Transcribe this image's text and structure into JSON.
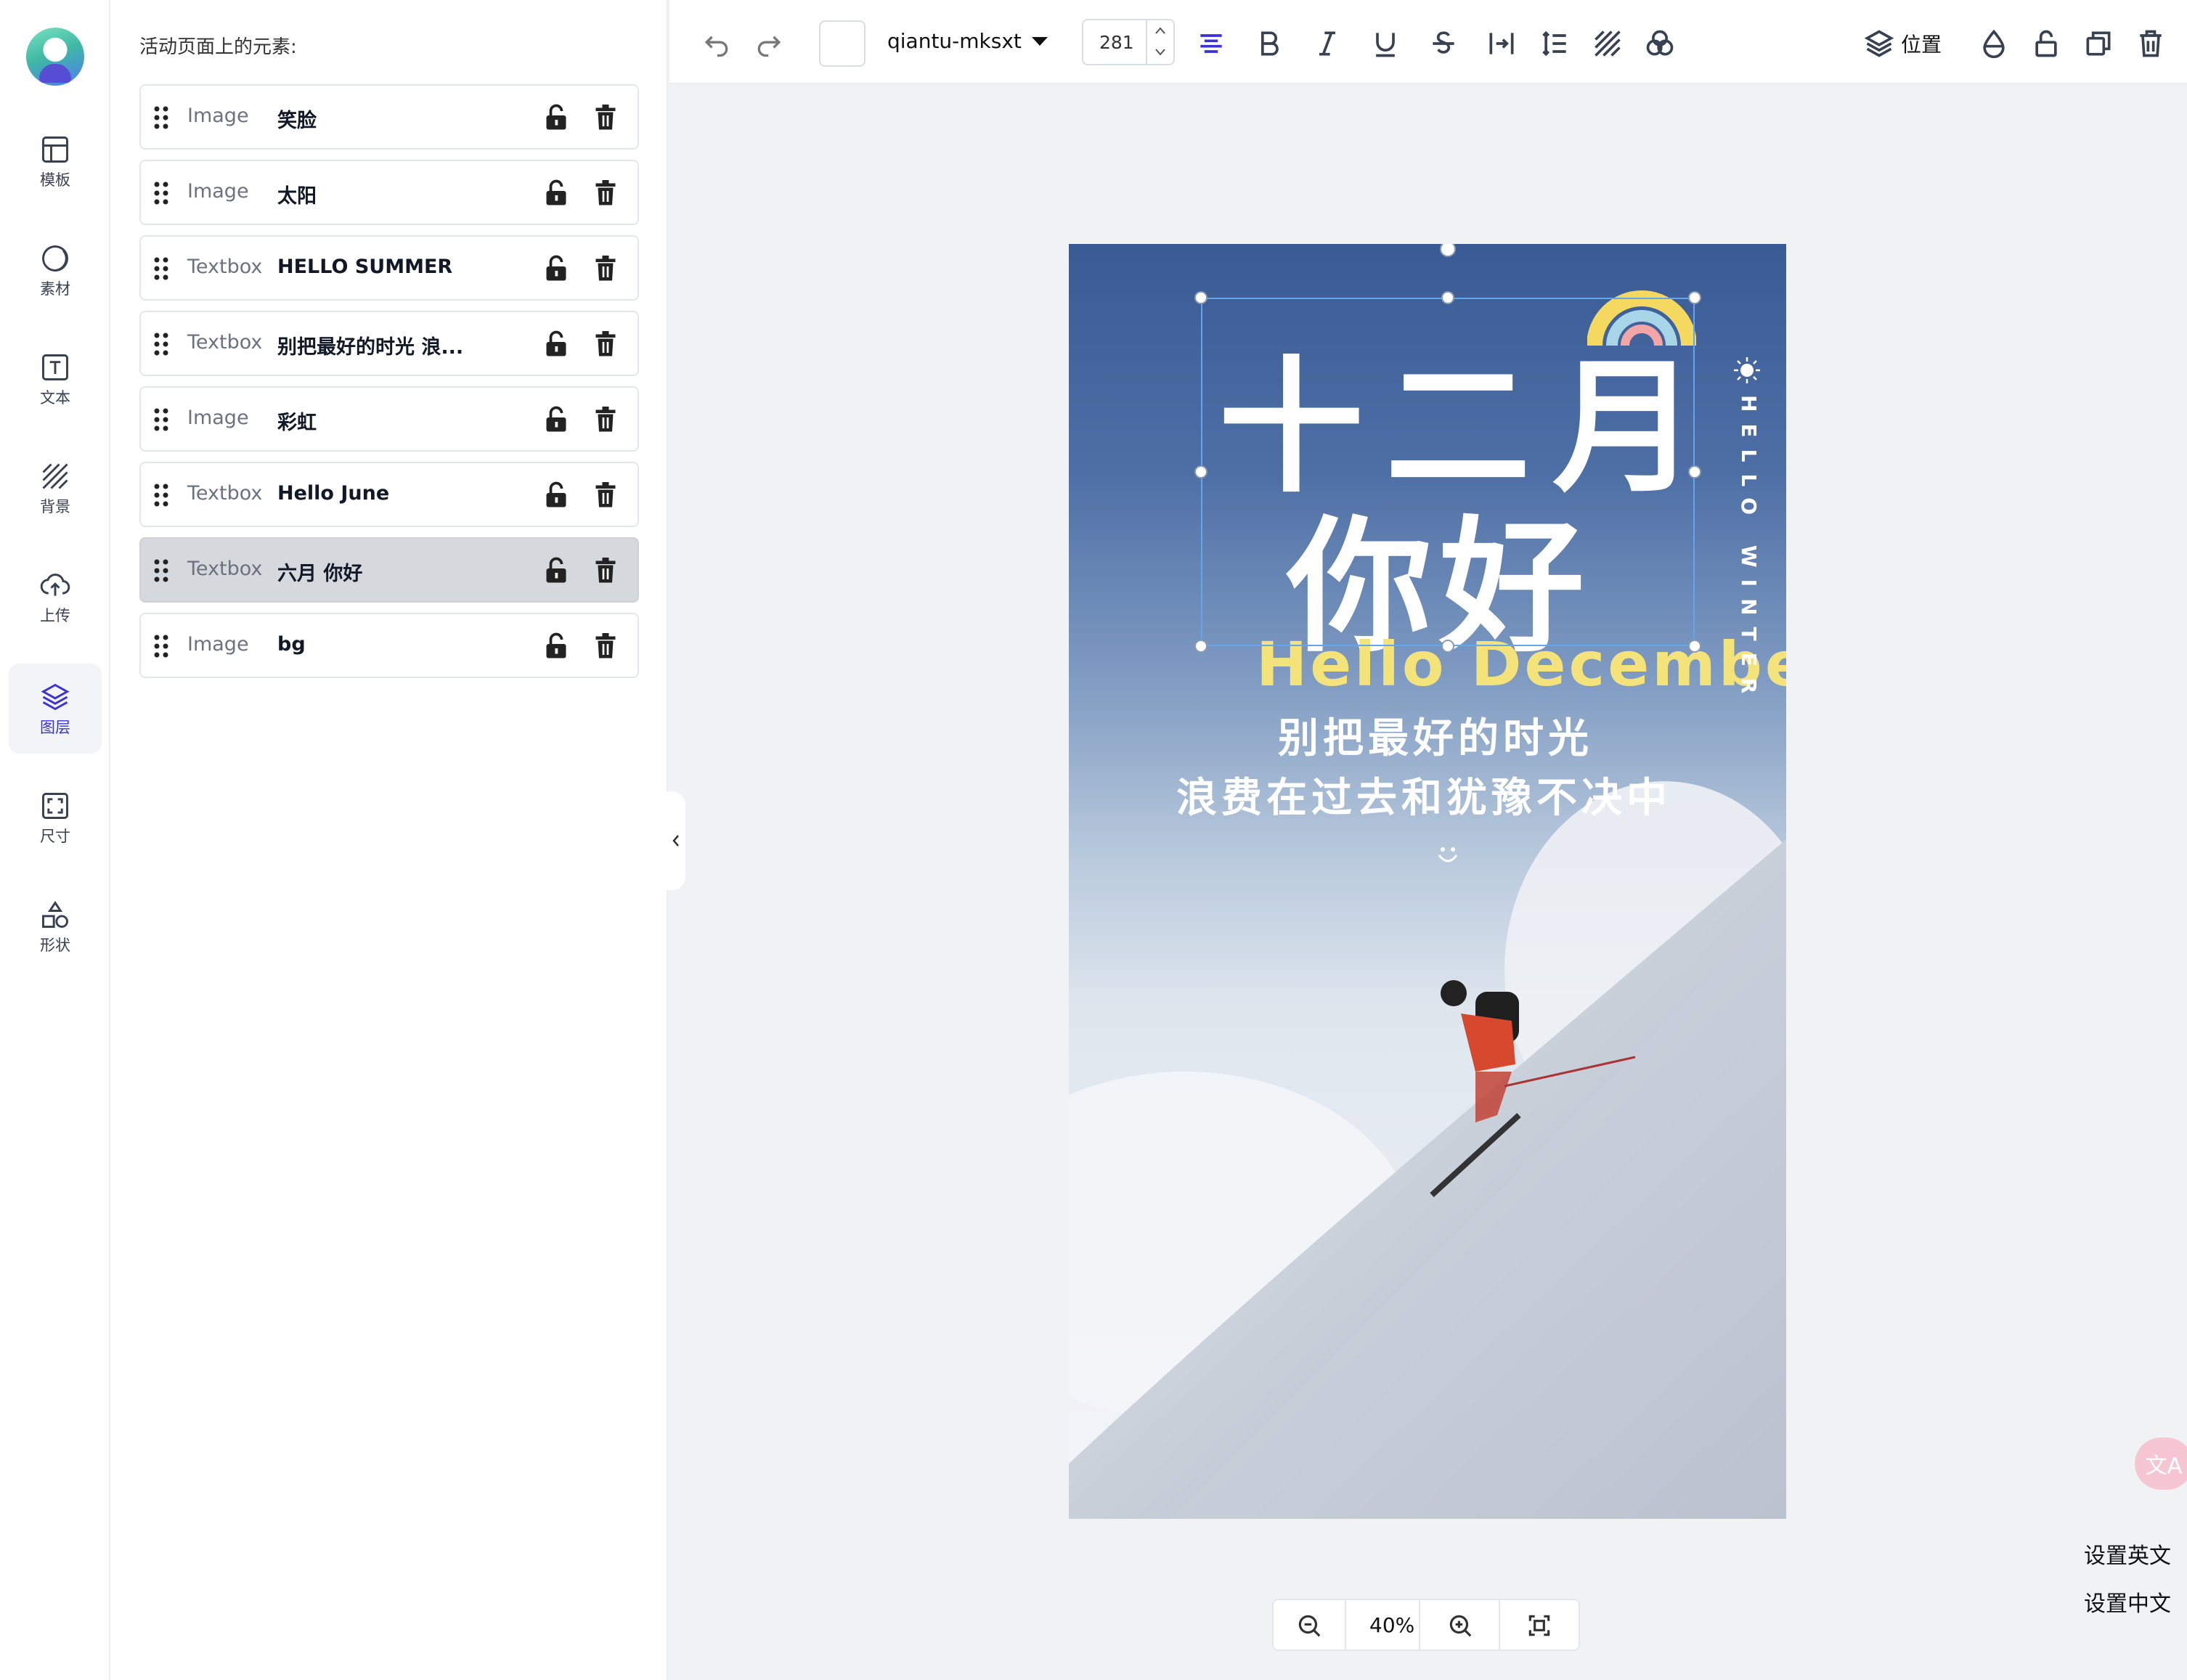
{
  "nav": {
    "items": [
      {
        "label": "模板",
        "icon": "template-icon"
      },
      {
        "label": "素材",
        "icon": "material-icon"
      },
      {
        "label": "文本",
        "icon": "text-icon"
      },
      {
        "label": "背景",
        "icon": "background-icon"
      },
      {
        "label": "上传",
        "icon": "upload-icon"
      },
      {
        "label": "图层",
        "icon": "layers-icon"
      },
      {
        "label": "尺寸",
        "icon": "size-icon"
      },
      {
        "label": "形状",
        "icon": "shapes-icon"
      }
    ],
    "active": "图层"
  },
  "layers_panel": {
    "title": "活动页面上的元素:",
    "items": [
      {
        "type": "Image",
        "name": "笑脸",
        "selected": false
      },
      {
        "type": "Image",
        "name": "太阳",
        "selected": false
      },
      {
        "type": "Textbox",
        "name": "HELLO SUMMER",
        "selected": false
      },
      {
        "type": "Textbox",
        "name": "别把最好的时光 浪...",
        "selected": false
      },
      {
        "type": "Image",
        "name": "彩虹",
        "selected": false
      },
      {
        "type": "Textbox",
        "name": "Hello June",
        "selected": false
      },
      {
        "type": "Textbox",
        "name": "六月 你好",
        "selected": true
      },
      {
        "type": "Image",
        "name": "bg",
        "selected": false
      }
    ]
  },
  "toolbar": {
    "font_family": "qiantu-mksxt",
    "font_size": "281",
    "position_label": "位置",
    "text_color": "#ffffff"
  },
  "poster": {
    "line1": "十二月",
    "line2": "你好",
    "hello": "Hello December",
    "sub1": "别把最好的时光",
    "sub2": "浪费在过去和犹豫不决中",
    "vertical": "HELLO WINTER",
    "smiley": "◡̈"
  },
  "zoom": {
    "level": "40%"
  },
  "lang": {
    "english": "设置英文",
    "chinese": "设置中文"
  },
  "translate_fab": "文A"
}
